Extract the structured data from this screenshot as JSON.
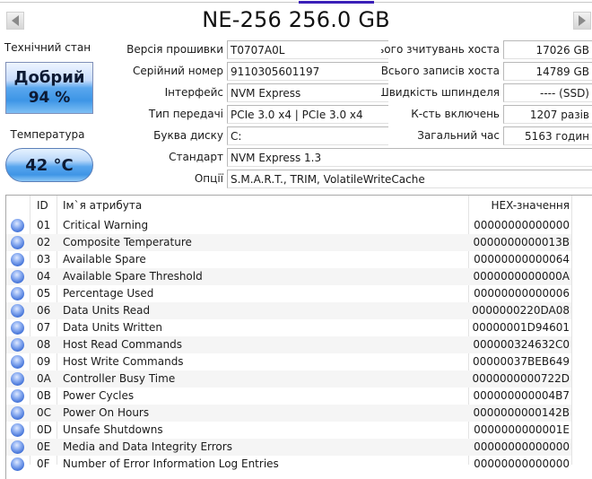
{
  "header": {
    "title": "NE-256 256.0 GB",
    "prev_label": "previous-disk",
    "next_label": "next-disk"
  },
  "status": {
    "health_label": "Технічний стан",
    "health_status": "Добрий",
    "health_percent": "94 %",
    "temperature_label": "Температура",
    "temperature_value": "42 °C",
    "colors": {
      "badge_blue": "#3d95e6",
      "dot_blue": "#3f6fd6",
      "tab_active": "#3a1fb8"
    }
  },
  "info_left": [
    {
      "label": "Версія прошивки",
      "value": "T0707A0L"
    },
    {
      "label": "Серійний номер",
      "value": "9110305601197"
    },
    {
      "label": "Інтерфейс",
      "value": "NVM Express"
    },
    {
      "label": "Тип передачі",
      "value": "PCIe 3.0 x4 | PCIe 3.0 x4"
    },
    {
      "label": "Буква диску",
      "value": "C:"
    },
    {
      "label": "Стандарт",
      "value": "NVM Express 1.3"
    },
    {
      "label": "Опції",
      "value": "S.M.A.R.T., TRIM, VolatileWriteCache"
    }
  ],
  "info_right": [
    {
      "label": "Всього зчитувань хоста",
      "value": "17026 GB"
    },
    {
      "label": "Всього записів хоста",
      "value": "14789 GB"
    },
    {
      "label": "Швидкість шпинделя",
      "value": "---- (SSD)"
    },
    {
      "label": "К-сть включень",
      "value": "1207 разів"
    },
    {
      "label": "Загальний час",
      "value": "5163 годин"
    }
  ],
  "table": {
    "columns": {
      "status": "",
      "id": "ID",
      "name": "Ім`я атрибута",
      "hex": "HEX-значення"
    },
    "rows": [
      {
        "id": "01",
        "name": "Critical Warning",
        "hex": "00000000000000"
      },
      {
        "id": "02",
        "name": "Composite Temperature",
        "hex": "0000000000013B"
      },
      {
        "id": "03",
        "name": "Available Spare",
        "hex": "00000000000064"
      },
      {
        "id": "04",
        "name": "Available Spare Threshold",
        "hex": "0000000000000A"
      },
      {
        "id": "05",
        "name": "Percentage Used",
        "hex": "00000000000006"
      },
      {
        "id": "06",
        "name": "Data Units Read",
        "hex": "0000000220DA08"
      },
      {
        "id": "07",
        "name": "Data Units Written",
        "hex": "00000001D94601"
      },
      {
        "id": "08",
        "name": "Host Read Commands",
        "hex": "000000324632C0"
      },
      {
        "id": "09",
        "name": "Host Write Commands",
        "hex": "00000037BEB649"
      },
      {
        "id": "0A",
        "name": "Controller Busy Time",
        "hex": "0000000000722D"
      },
      {
        "id": "0B",
        "name": "Power Cycles",
        "hex": "000000000004B7"
      },
      {
        "id": "0C",
        "name": "Power On Hours",
        "hex": "0000000000142B"
      },
      {
        "id": "0D",
        "name": "Unsafe Shutdowns",
        "hex": "0000000000001E"
      },
      {
        "id": "0E",
        "name": "Media and Data Integrity Errors",
        "hex": "00000000000000"
      },
      {
        "id": "0F",
        "name": "Number of Error Information Log Entries",
        "hex": "00000000000000"
      }
    ]
  }
}
